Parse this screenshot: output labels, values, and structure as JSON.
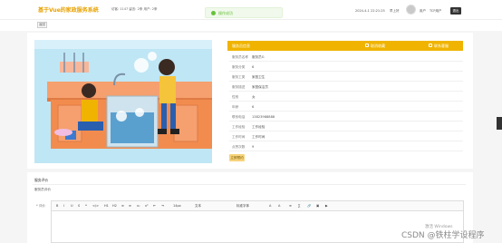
{
  "header": {
    "brand": "基于Vue的家政服务系统",
    "meta": "访客: 1147  留言: 2条  用户: 2条",
    "toast": "操作成功",
    "datetime": "2024-4-1 22:21:25",
    "greeting": "早上好",
    "role": "用户",
    "username": "TCP用户",
    "logout": "退出"
  },
  "subbar": {
    "back_label": "返回"
  },
  "panel": {
    "title": "服务员信息",
    "action_collect": "取消收藏",
    "action_contact": "联系客服",
    "fields": [
      {
        "key": "服务员名称",
        "value": "服务员G"
      },
      {
        "key": "服务分类",
        "value": "6"
      },
      {
        "key": "服务工类",
        "value": "家庭卫生"
      },
      {
        "key": "服务描述",
        "value": "家庭保洁员"
      },
      {
        "key": "性别",
        "value": "女"
      },
      {
        "key": "年龄",
        "value": "6"
      },
      {
        "key": "联系电话",
        "value": "13823988888"
      },
      {
        "key": "工作经验",
        "value": "工作经验"
      },
      {
        "key": "工作时间",
        "value": "工作时间"
      },
      {
        "key": "点赞次数",
        "value": "9"
      }
    ],
    "hire_label": "立即预约"
  },
  "evaluation": {
    "heading": "服务评价",
    "hint": "服务员评价",
    "content_label": "* 评价",
    "toolbar": [
      "B",
      "I",
      "U",
      "S",
      "❝",
      "</>",
      "H1",
      "H2",
      "≡",
      "≡",
      "x₂",
      "x²",
      "⇤",
      "⇥",
      "14px",
      "文本",
      "标准字体",
      "A",
      "A",
      "≡",
      "∑",
      "🔗",
      "▣",
      "▶"
    ]
  },
  "watermark": "激活 Windows",
  "overlay_credit": "CSDN @铁柱学设程序",
  "colors": {
    "accent": "#f0b400",
    "success": "#67c23a",
    "topbar": "#ffffff"
  }
}
